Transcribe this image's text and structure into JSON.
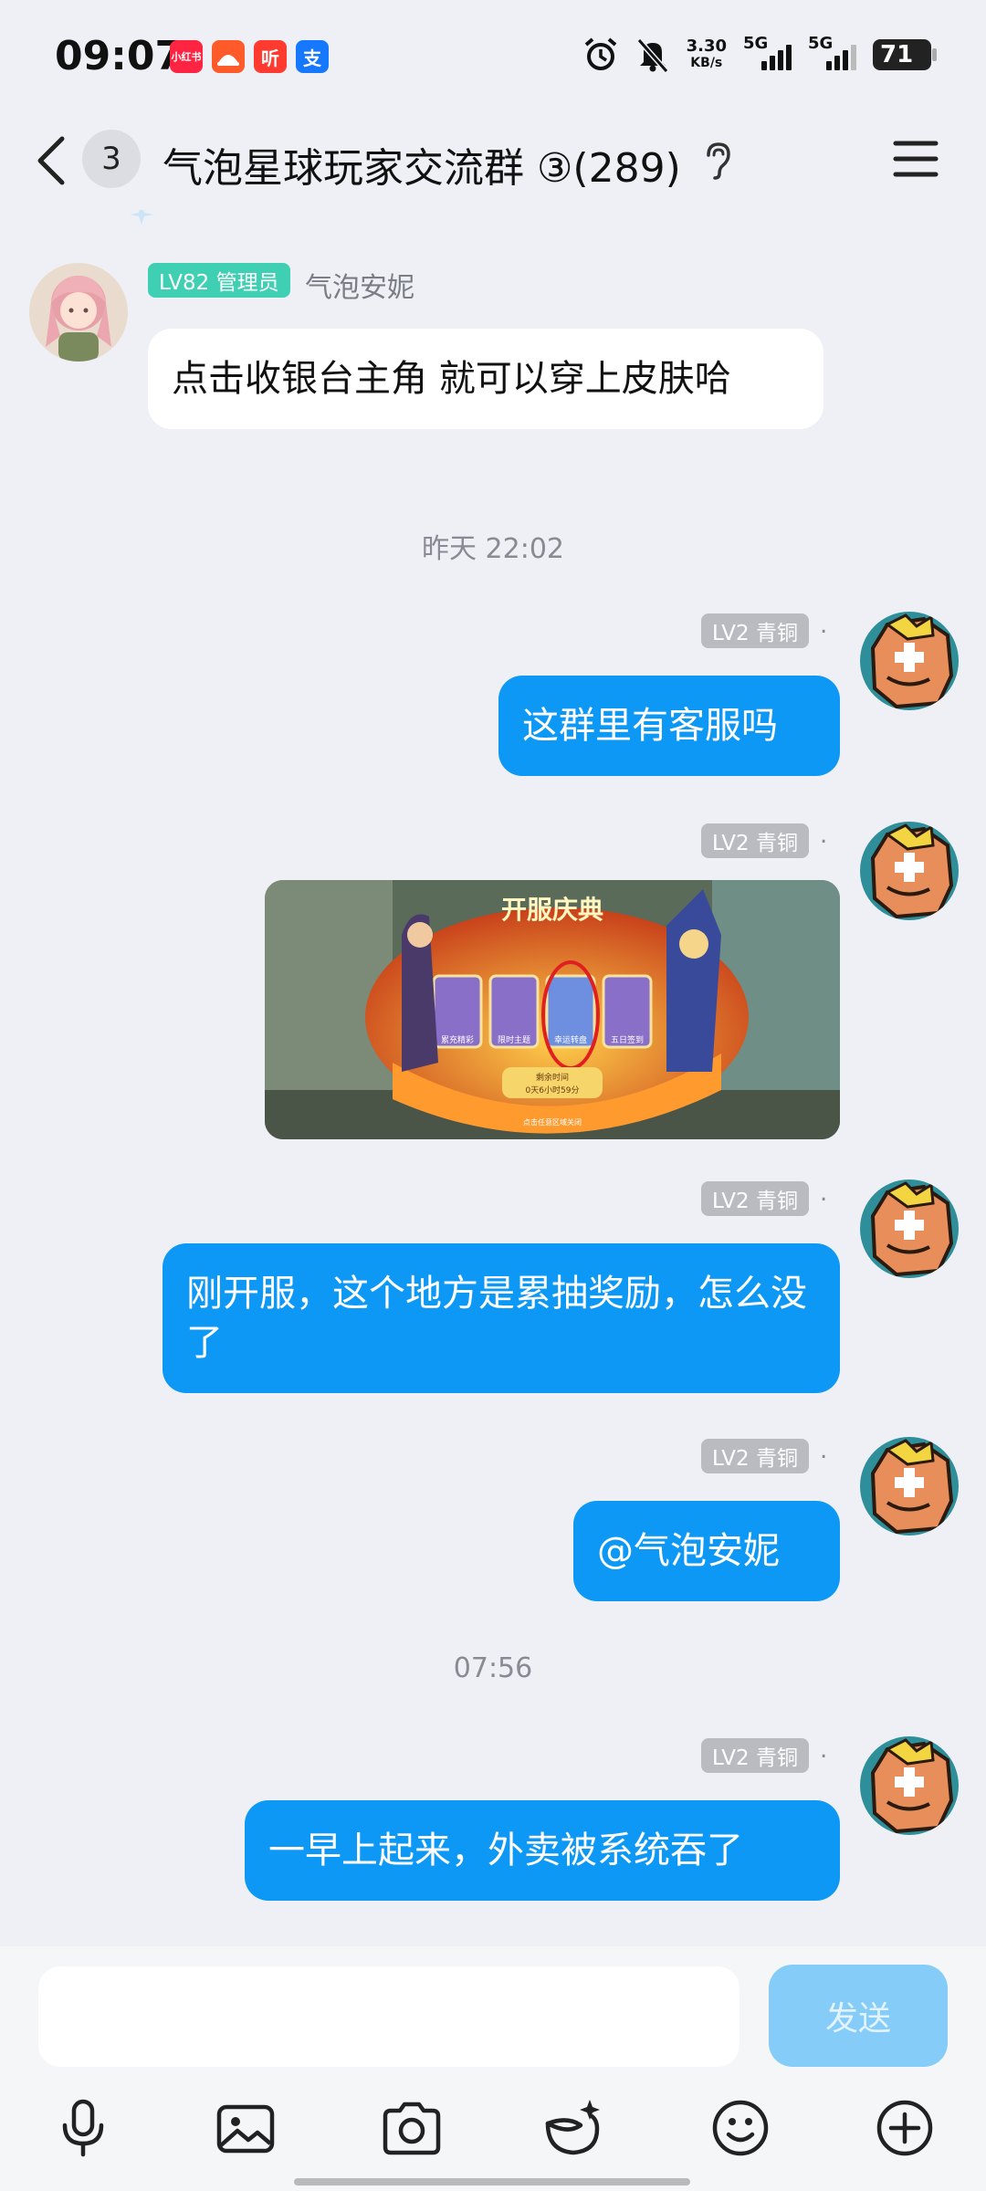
{
  "status_bar": {
    "time": "09:07",
    "app_icons": [
      {
        "label": "小红书",
        "color": "#ff2442"
      },
      {
        "label": "●",
        "color": "#ff5a2a"
      },
      {
        "label": "听",
        "color": "#ff3b30"
      },
      {
        "label": "支",
        "color": "#1677ff"
      }
    ],
    "net_speed": "3.30",
    "net_unit": "KB/s",
    "sim1": "5G",
    "sim2": "5G",
    "battery": "71"
  },
  "header": {
    "unread_count": "3",
    "title": "气泡星球玩家交流群 ③(289)"
  },
  "messages": {
    "m1": {
      "badge": "LV82 管理员",
      "sender": "气泡安妮",
      "text": "点击收银台主角 就可以穿上皮肤哈"
    },
    "t1": "昨天 22:02",
    "m2": {
      "badge": "LV2 青铜",
      "name": ".",
      "text": "这群里有客服吗"
    },
    "m3": {
      "badge": "LV2 青铜",
      "name": ".",
      "image": {
        "title": "开服庆典",
        "card1": "累充精彩",
        "card2": "限时主题",
        "card3": "幸运转盘",
        "card4": "五日签到",
        "remain_label": "剩余时间",
        "remain_value": "0天6小时59分",
        "footer": "点击任意区域关闭"
      }
    },
    "m4": {
      "badge": "LV2 青铜",
      "name": ".",
      "text": "刚开服，这个地方是累抽奖励，怎么没了"
    },
    "m5": {
      "badge": "LV2 青铜",
      "name": ".",
      "text": "@气泡安妮"
    },
    "t2": "07:56",
    "m6": {
      "badge": "LV2 青铜",
      "name": ".",
      "text": "一早上起来，外卖被系统吞了"
    }
  },
  "input": {
    "placeholder": "",
    "send_label": "发送"
  },
  "colors": {
    "out_bubble": "#0e98f5",
    "admin_badge": "#3fcfb2",
    "member_badge": "#b9bbc1",
    "send_disabled": "#86ccf8"
  }
}
